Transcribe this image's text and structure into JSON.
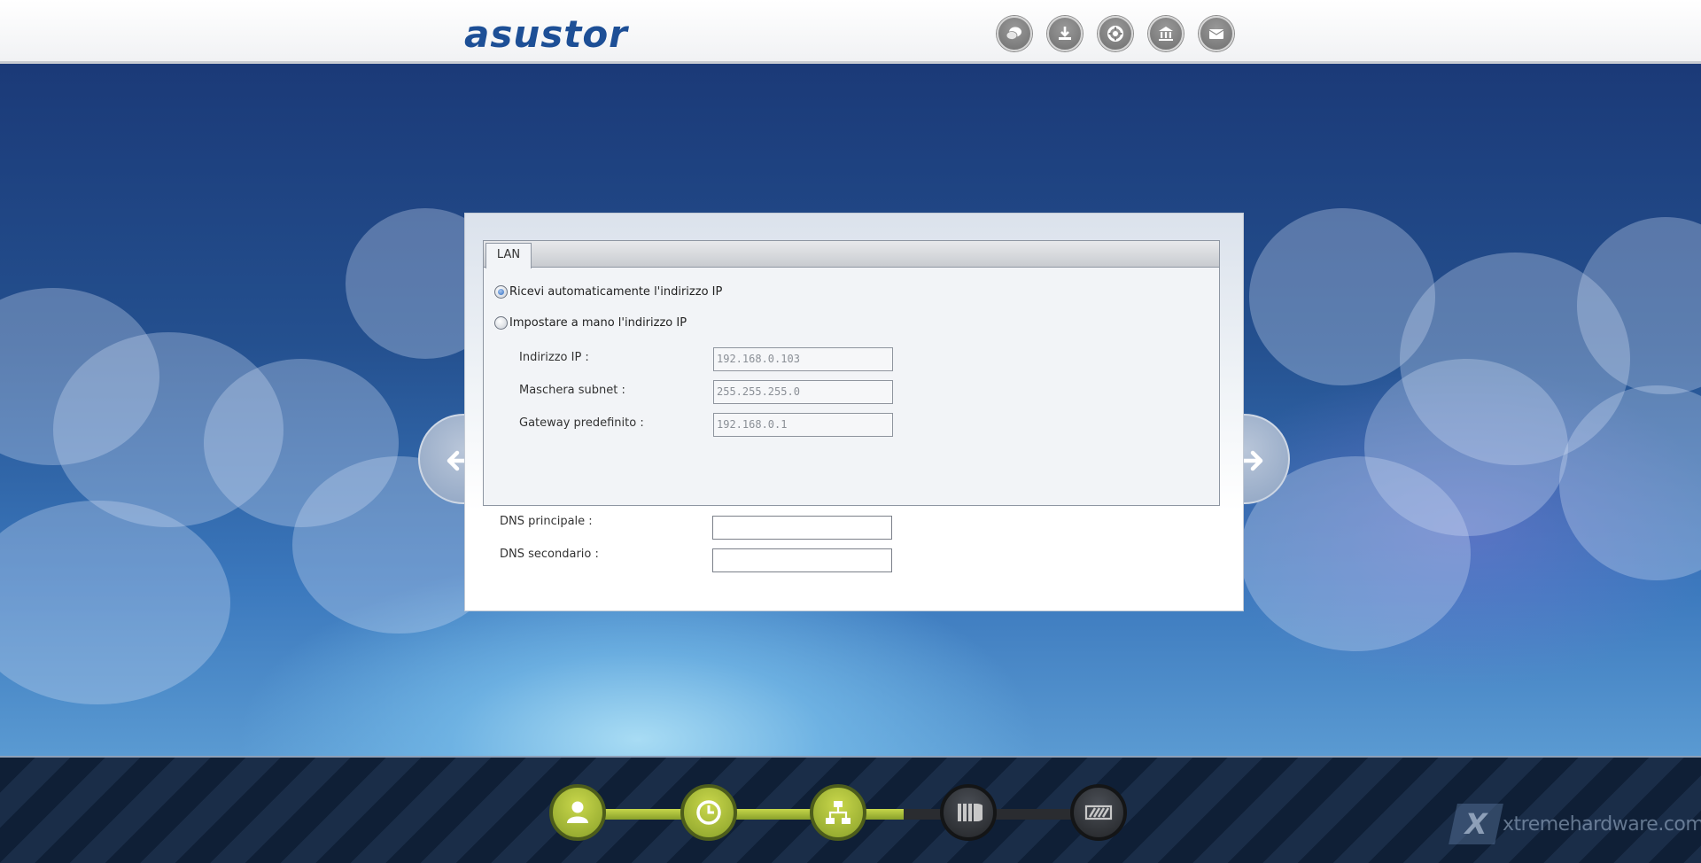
{
  "header": {
    "logo_text": "asustor",
    "icons": [
      "chat-icon",
      "download-icon",
      "support-icon",
      "bank-icon",
      "mail-icon"
    ]
  },
  "panel": {
    "tab_label": "LAN",
    "radio_auto_label": "Ricevi automaticamente l'indirizzo IP",
    "radio_manual_label": "Impostare a mano l'indirizzo IP",
    "radio_auto_selected": true,
    "fields": {
      "ip_label": "Indirizzo IP :",
      "ip_value": "192.168.0.103",
      "subnet_label": "Maschera subnet :",
      "subnet_value": "255.255.255.0",
      "gateway_label": "Gateway predefinito :",
      "gateway_value": "192.168.0.1",
      "dns1_label": "DNS principale :",
      "dns1_value": "",
      "dns2_label": "DNS secondario :",
      "dns2_value": ""
    }
  },
  "wizard": {
    "steps": [
      {
        "icon": "user-icon",
        "state": "done"
      },
      {
        "icon": "clock-icon",
        "state": "done"
      },
      {
        "icon": "network-icon",
        "state": "done"
      },
      {
        "icon": "storage-icon",
        "state": "todo"
      },
      {
        "icon": "finish-icon",
        "state": "todo"
      }
    ],
    "accent_color": "#a9bd34"
  },
  "watermark": {
    "mark": "X",
    "text": "xtremehardware.com"
  }
}
